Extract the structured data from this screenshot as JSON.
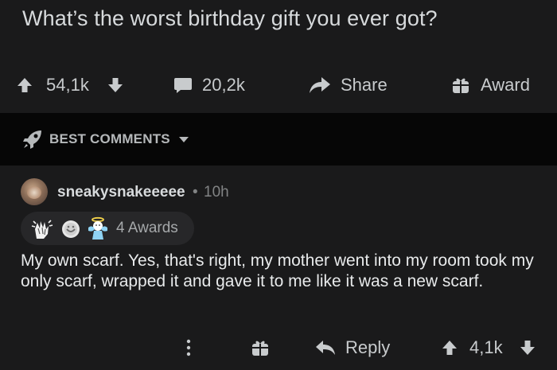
{
  "post": {
    "title": "What’s the worst birthday gift you ever got?"
  },
  "actions": {
    "upvotes": "54,1k",
    "comments": "20,2k",
    "share_label": "Share",
    "award_label": "Award"
  },
  "sort": {
    "label": "BEST COMMENTS"
  },
  "comment": {
    "username": "sneakysnakeeeee",
    "separator": "•",
    "time": "10h",
    "awards_label": "4 Awards",
    "body": "My own scarf. Yes, that's right, my mother went into my room took my only scarf, wrapped it and gave it to me like it was a new scarf.",
    "reply_label": "Reply",
    "votes": "4,1k"
  },
  "icons": {
    "upvote": "arrow-up-icon",
    "downvote": "arrow-down-icon",
    "comments": "speech-bubble-icon",
    "share": "share-arrow-icon",
    "award": "gift-icon",
    "sort": "rocket-icon",
    "dropdown": "caret-down-icon",
    "more": "vertical-dots-icon",
    "reply": "reply-arrow-icon"
  },
  "colors": {
    "background": "#1a1a1b",
    "section_bar": "#060606",
    "text": "#d7dadc",
    "muted": "#818384",
    "pill": "#272729"
  }
}
